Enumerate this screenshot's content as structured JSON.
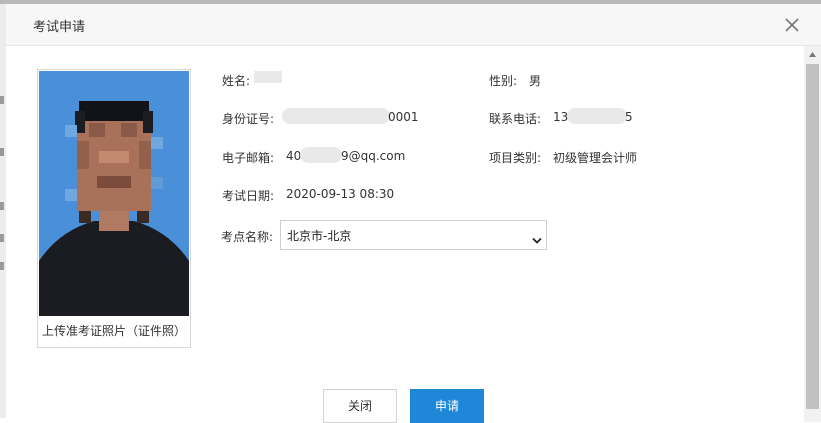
{
  "dialog": {
    "title": "考试申请"
  },
  "photo": {
    "caption": "上传准考证照片（证件照）"
  },
  "form": {
    "name_label": "姓名:",
    "gender_label": "性别:",
    "gender_value": "男",
    "id_label": "身份证号:",
    "id_value_visible": "0001",
    "phone_label": "联系电话:",
    "phone_prefix": "13",
    "phone_suffix": "5",
    "email_label": "电子邮箱:",
    "email_prefix": "40",
    "email_suffix": "9@qq.com",
    "category_label": "项目类别:",
    "category_value": "初级管理会计师",
    "date_label": "考试日期:",
    "date_value": "2020-09-13 08:30",
    "site_label": "考点名称:",
    "site_selected": "北京市-北京"
  },
  "buttons": {
    "close_label": "关闭",
    "apply_label": "申请"
  },
  "colors": {
    "primary": "#1e87d7",
    "photo_background": "#4a90d9"
  }
}
